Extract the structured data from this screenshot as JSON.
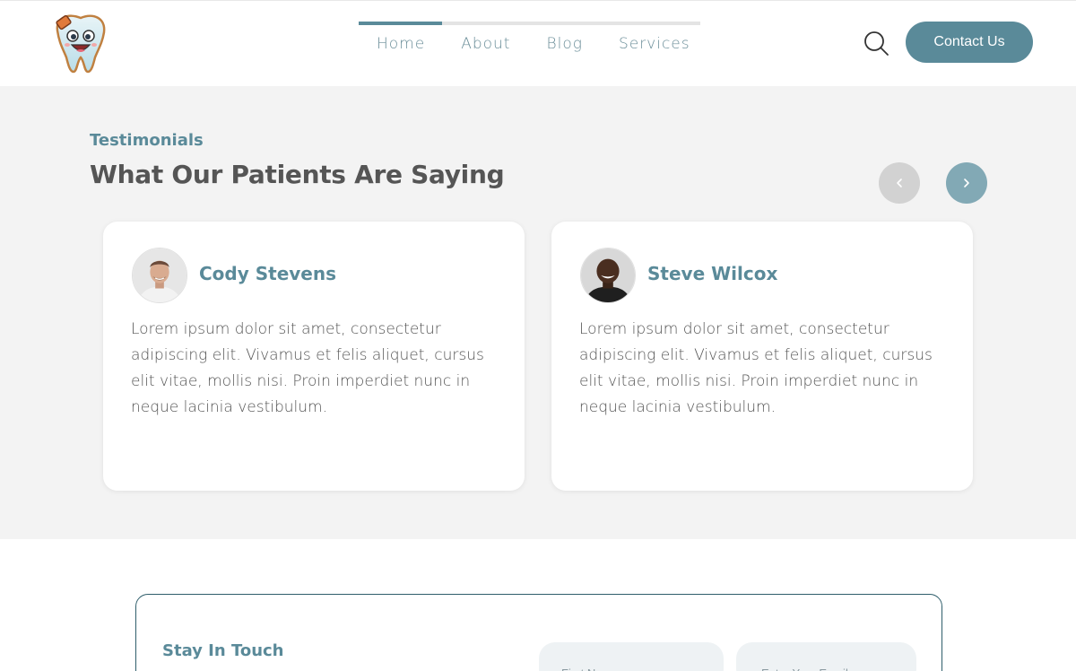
{
  "header": {
    "logo_icon": "tooth-mascot-logo",
    "nav": [
      {
        "label": "Home",
        "active": true
      },
      {
        "label": "About",
        "active": false
      },
      {
        "label": "Blog",
        "active": false
      },
      {
        "label": "Services",
        "active": false
      }
    ],
    "search_icon": "search-icon",
    "contact_label": "Contact Us"
  },
  "testimonials": {
    "eyebrow": "Testimonials",
    "title": "What Our Patients Are Saying",
    "prev_icon": "chevron-left-icon",
    "next_icon": "chevron-right-icon",
    "cards": [
      {
        "name": "Cody Stevens",
        "text": "Lorem ipsum dolor sit amet, consectetur adipiscing elit. Vivamus et felis aliquet, cursus elit vitae, mollis nisi. Proin imperdiet nunc in neque lacinia vestibulum."
      },
      {
        "name": "Steve Wilcox",
        "text": "Lorem ipsum dolor sit amet, consectetur adipiscing elit. Vivamus et felis aliquet, cursus elit vitae, mollis nisi. Proin imperdiet nunc in neque lacinia vestibulum."
      }
    ]
  },
  "stay_in_touch": {
    "title": "Stay In Touch",
    "first_name_placeholder": "First Name",
    "email_placeholder": "Enter Your Email"
  },
  "colors": {
    "accent": "#5a8a99",
    "section_bg": "#f3f3f3",
    "title_text": "#555555"
  }
}
